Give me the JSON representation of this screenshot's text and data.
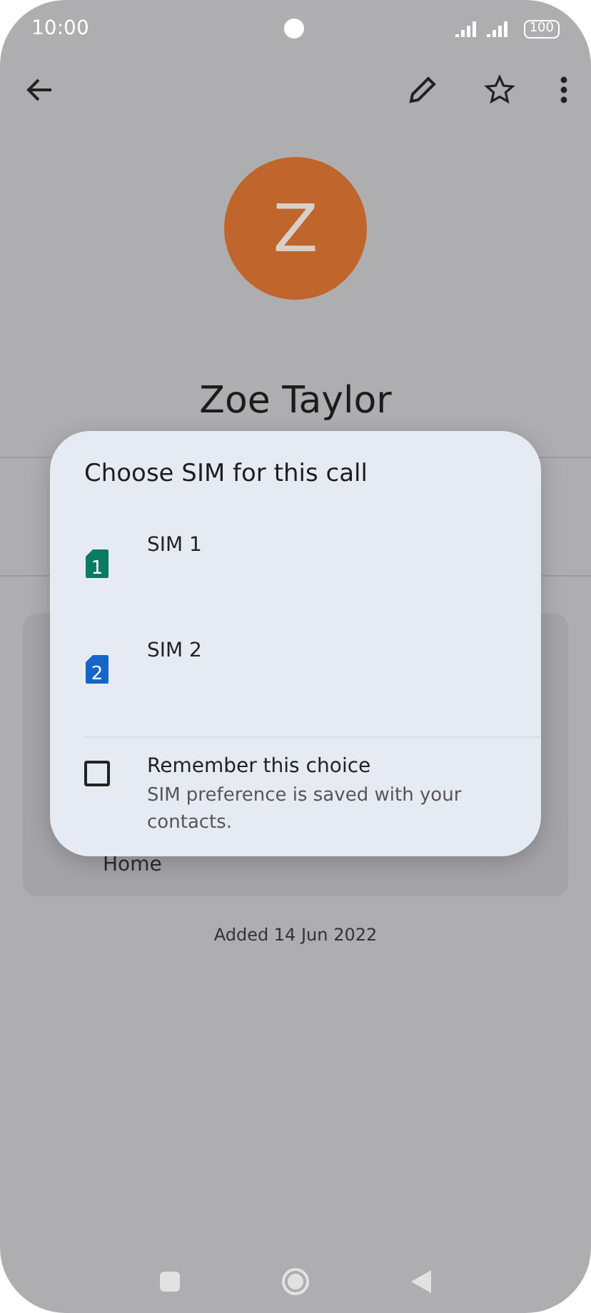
{
  "status_bar": {
    "time": "10:00",
    "battery": "100"
  },
  "contact": {
    "initial": "Z",
    "name": "Zoe Taylor",
    "address_label": "Home",
    "added": "Added 14 Jun 2022"
  },
  "dialog": {
    "title": "Choose SIM for this call",
    "sims": [
      {
        "label": "SIM 1",
        "number": "1",
        "color": "#0b7a63"
      },
      {
        "label": "SIM 2",
        "number": "2",
        "color": "#1565c8"
      }
    ],
    "remember": {
      "label": "Remember this choice",
      "hint": "SIM preference is saved with your contacts.",
      "checked": false
    }
  }
}
